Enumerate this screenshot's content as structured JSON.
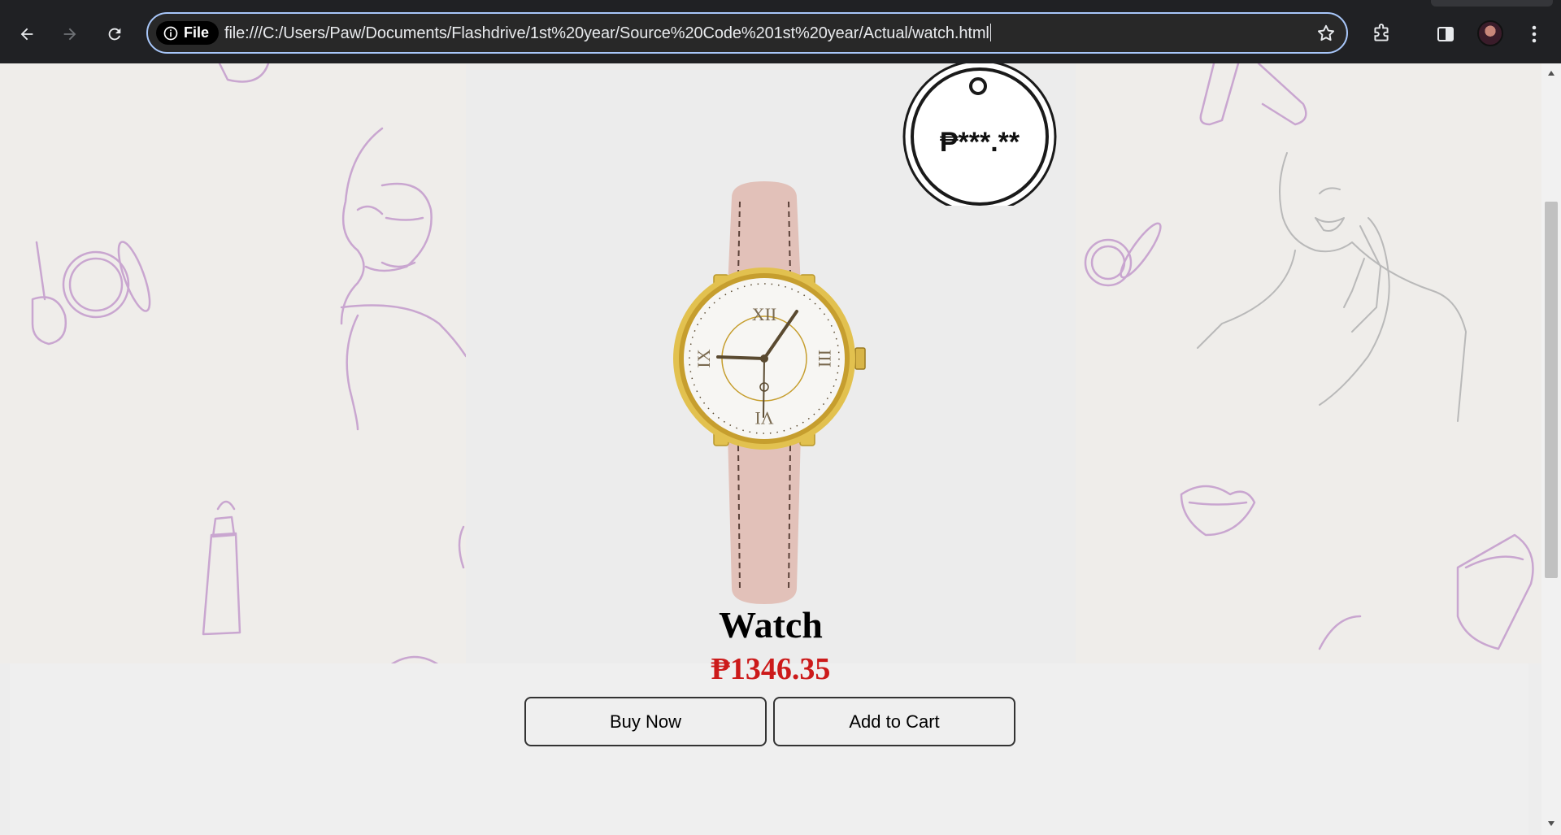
{
  "browser": {
    "file_chip_label": "File",
    "url": "file:///C:/Users/Paw/Documents/Flashdrive/1st%20year/Source%20Code%201st%20year/Actual/watch.html"
  },
  "price_tag": {
    "text": "₱***.**"
  },
  "product": {
    "title": "Watch",
    "price": "₱1346.35",
    "buy_now_label": "Buy Now",
    "add_to_cart_label": "Add to Cart"
  },
  "watch_face": {
    "numerals": [
      "XII",
      "III",
      "VI",
      "IX"
    ]
  },
  "colors": {
    "price_red": "#cc1a1a",
    "strap_pink": "#e2c1b9",
    "case_gold": "#e2c14f",
    "doodle_purple": "#c9a6d0"
  }
}
